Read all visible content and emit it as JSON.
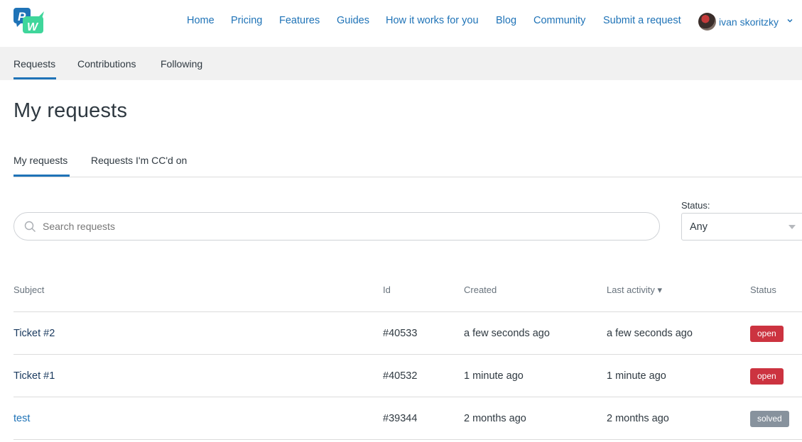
{
  "header": {
    "logo": {
      "icon": "pw-logo-icon",
      "colors": {
        "blue": "#1f73b7",
        "green": "#3fd69b"
      },
      "letters": [
        "P",
        "W"
      ]
    },
    "nav": [
      "Home",
      "Pricing",
      "Features",
      "Guides",
      "How it works for you",
      "Blog",
      "Community",
      "Submit a request"
    ],
    "user": {
      "name": "ivan skoritzky",
      "icon": "chevron-down-icon"
    }
  },
  "subnav": {
    "tabs": [
      "Requests",
      "Contributions",
      "Following"
    ],
    "active": "Requests"
  },
  "page": {
    "title": "My requests"
  },
  "tabs": {
    "items": [
      "My requests",
      "Requests I'm CC'd on"
    ],
    "active": "My requests"
  },
  "search": {
    "placeholder": "Search requests",
    "value": "",
    "icon": "search-icon"
  },
  "filter": {
    "label": "Status:",
    "value": "Any"
  },
  "table": {
    "columns": {
      "subject": "Subject",
      "id": "Id",
      "created": "Created",
      "last_activity": "Last activity ▾",
      "status": "Status"
    },
    "rows": [
      {
        "subject": "Ticket #2",
        "id": "#40533",
        "created": "a few seconds ago",
        "last_activity": "a few seconds ago",
        "status": "open"
      },
      {
        "subject": "Ticket #1",
        "id": "#40532",
        "created": "1 minute ago",
        "last_activity": "1 minute ago",
        "status": "open"
      },
      {
        "subject": "test",
        "id": "#39344",
        "created": "2 months ago",
        "last_activity": "2 months ago",
        "status": "solved"
      }
    ]
  },
  "colors": {
    "accent": "#1f73b7",
    "open": "#cc3340",
    "solved": "#87929d"
  }
}
